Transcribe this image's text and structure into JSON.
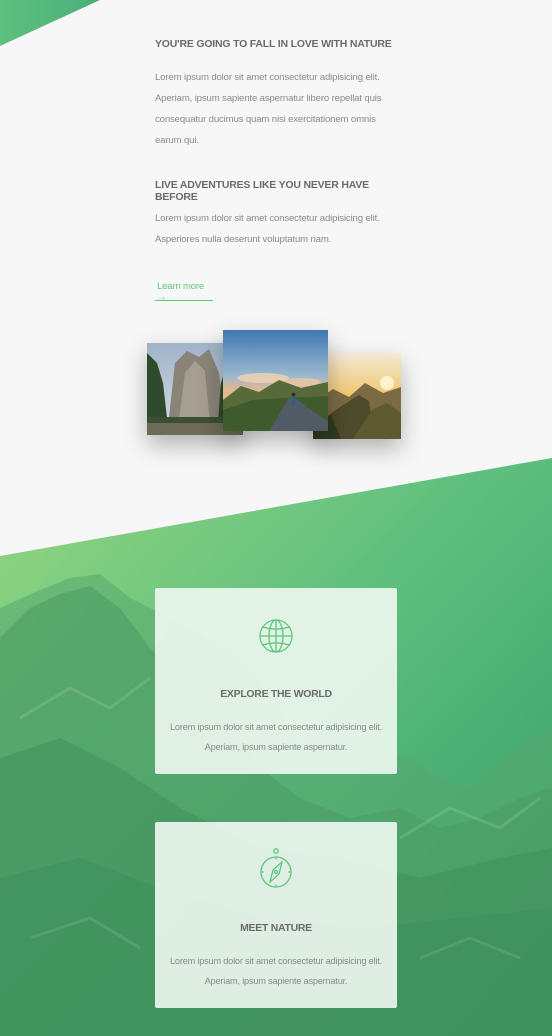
{
  "intro": {
    "heading1": "YOU'RE GOING TO FALL IN LOVE WITH NATURE",
    "para1": "Lorem ipsum dolor sit amet consectetur adipisicing elit. Aperiam, ipsum sapiente aspernatur libero repellat quis consequatur ducimus quam nisi exercitationem omnis earum qui.",
    "heading2": "LIVE ADVENTURES LIKE YOU NEVER HAVE BEFORE",
    "para2": "Lorem ipsum dolor sit amet consectetur adipisicing elit. Asperiores nulla deserunt voluptatum nam.",
    "learn_more": "Learn more →"
  },
  "gallery": {
    "photos": [
      "valley-cliffs-photo",
      "road-hiker-photo",
      "mountain-ridge-sunset-photo"
    ]
  },
  "features": [
    {
      "icon": "globe-icon",
      "title": "EXPLORE THE WORLD",
      "text": "Lorem ipsum dolor sit amet consectetur adipisicing elit. Aperiam, ipsum sapiente aspernatur."
    },
    {
      "icon": "compass-icon",
      "title": "MEET NATURE",
      "text": "Lorem ipsum dolor sit amet consectetur adipisicing elit. Aperiam, ipsum sapiente aspernatur."
    }
  ],
  "colors": {
    "accent": "#5fc67c",
    "gradient_light": "#8fd67f",
    "gradient_dark": "#2e9a6a",
    "background": "#f7f7f7",
    "heading": "#6b6b6b",
    "body_text": "#8a8a8a"
  }
}
